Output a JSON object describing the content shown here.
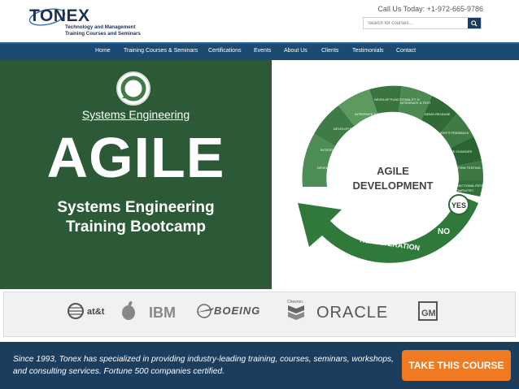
{
  "header": {
    "logo_word": "TONEX",
    "logo_tagline_1": "Technology and Management",
    "logo_tagline_2": "Training Courses and Seminars",
    "call_text": "Call Us Today: +1-972-665-9786",
    "search_placeholder": "Search for courses..."
  },
  "nav": {
    "items": [
      "Home",
      "Training Courses & Seminars",
      "Certifications",
      "Events",
      "About Us",
      "Clients",
      "Testimonials",
      "Contact"
    ]
  },
  "hero": {
    "subtitle": "Systems Engineering",
    "title": "AGILE",
    "tagline_1": "Systems Engineering",
    "tagline_2": "Training Bootcamp"
  },
  "diagram": {
    "center_1": "AGILE",
    "center_2": "DEVELOPMENT",
    "segments": [
      "DEVELOP FUNCTIONALITY 1",
      "INTEGRATE & TEST",
      "DEVELOP FUNCTIONALITY 2",
      "INTEGRATE & TEST",
      "DEVELOP FUNCTIONALITY N",
      "INTEGRATE & TEST",
      "DEMO RELEASE",
      "CLIENT'S FEEDBACK",
      "MAKE CHANGES",
      "SYSTEM TESTING"
    ],
    "question_1": "ALL FUNCTIONALITIES",
    "question_2": "COMPLETE?",
    "yes": "YES",
    "no": "NO",
    "next": "NEXT ITERATION"
  },
  "clients": {
    "logos": [
      "at&t",
      "IBM",
      "BOEING",
      "Chevron",
      "ORACLE",
      "GM"
    ]
  },
  "footer": {
    "text": "Since 1993, Tonex has specialized in providing industry-leading training, courses, seminars, workshops, and consulting services. Fortune 500 companies certified.",
    "cta": "TAKE THIS COURSE"
  },
  "colors": {
    "nav_bg": "#1b4b73",
    "hero_green": "#2d5a36",
    "footer_bg": "#1b3d5e",
    "cta_orange": "#ef7a22"
  }
}
